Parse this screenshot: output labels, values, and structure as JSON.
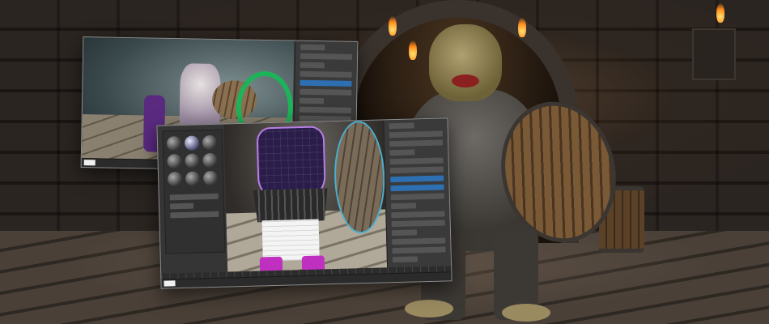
{
  "scene": {
    "description_colors": {
      "wall": "#2b2521",
      "torch_flame": "#ff8a1a",
      "ring_gizmo": "#1db35a",
      "wireframe_selection": "#b77ee6",
      "ui_panel": "#353535",
      "ui_accent": "#2d6fb0"
    }
  },
  "windows": [
    {
      "id": "viewport-window-1",
      "panel_rows": 12,
      "status_text": ""
    },
    {
      "id": "viewport-window-2",
      "material_slots": 9,
      "panel_rows": 16,
      "status_text": ""
    }
  ],
  "icons": [
    "torch-icon",
    "material-sphere-icon",
    "transform-gizmo-icon"
  ]
}
